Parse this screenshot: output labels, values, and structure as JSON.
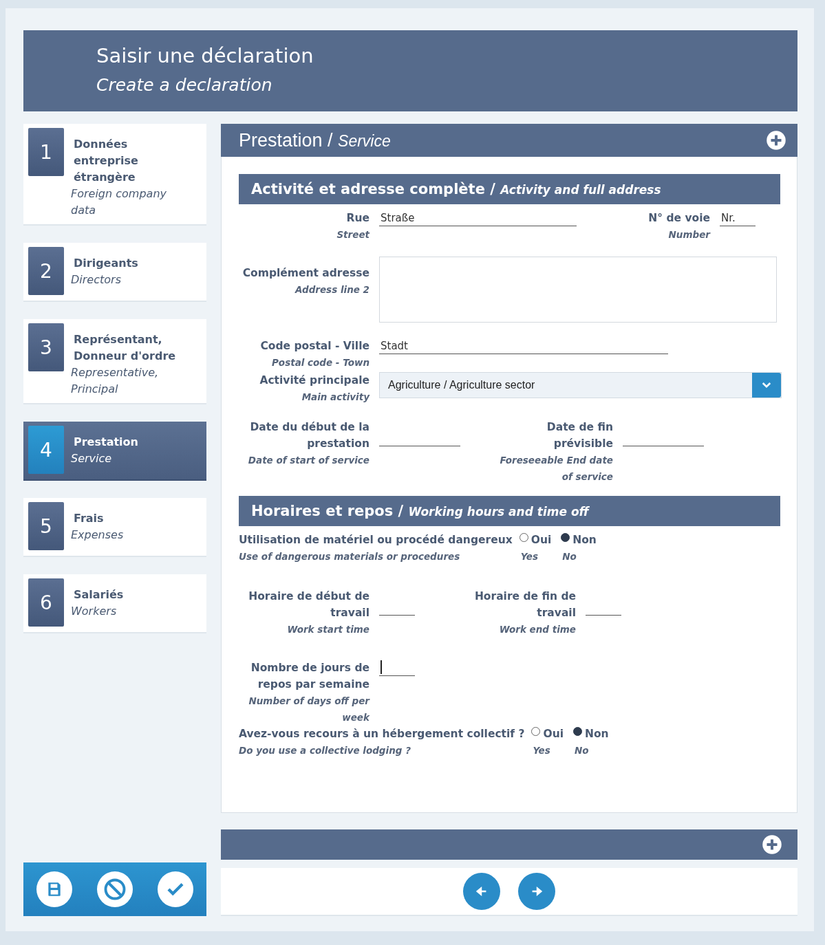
{
  "header": {
    "title": "Saisir une déclaration",
    "subtitle": "Create a declaration"
  },
  "steps": [
    {
      "number": "1",
      "title": "Données entreprise étrangère",
      "subtitle": "Foreign company data",
      "selected": false
    },
    {
      "number": "2",
      "title": "Dirigeants",
      "subtitle": "Directors",
      "selected": false
    },
    {
      "number": "3",
      "title": "Représentant, Donneur d'ordre",
      "subtitle": "Representative, Principal",
      "selected": false
    },
    {
      "number": "4",
      "title": "Prestation",
      "subtitle": "Service",
      "selected": true
    },
    {
      "number": "5",
      "title": "Frais",
      "subtitle": "Expenses",
      "selected": false
    },
    {
      "number": "6",
      "title": "Salariés",
      "subtitle": "Workers",
      "selected": false
    }
  ],
  "panel": {
    "title": "Prestation / *Service*"
  },
  "address_section": {
    "title": "Activité et adresse complète / *Activity and full address*",
    "street": {
      "label": "Rue",
      "label_en": "Street",
      "value": "Straße"
    },
    "number": {
      "label": "N° de voie",
      "label_en": "Number",
      "value": "Nr."
    },
    "address2": {
      "label": "Complément adresse",
      "label_en": "Address line 2"
    },
    "postal": {
      "label": "Code postal - Ville",
      "label_en": "Postal code - Town",
      "value": "Stadt"
    },
    "activity": {
      "label": "Activité principale",
      "label_en": "Main activity",
      "value": "Agriculture / Agriculture sector"
    },
    "start_date": {
      "label": "Date du début de la prestation",
      "label_en": "Date of start of service"
    },
    "end_date": {
      "label": "Date de fin prévisible",
      "label_en": "Foreseeable End date of service"
    }
  },
  "hours_section": {
    "title": "Horaires et repos / *Working hours and time off*",
    "dangerous": {
      "label": "Utilisation de matériel ou procédé dangereux",
      "label_en": "Use of dangerous materials or procedures",
      "options": [
        {
          "label": "Oui",
          "label_en": "Yes",
          "selected": false
        },
        {
          "label": "Non",
          "label_en": "No",
          "selected": true
        }
      ]
    },
    "start_time": {
      "label": "Horaire de début de travail",
      "label_en": "Work start time"
    },
    "end_time": {
      "label": "Horaire de fin de travail",
      "label_en": "Work end time"
    },
    "days_off": {
      "label": "Nombre de jours de repos par semaine",
      "label_en": "Number of days off per week",
      "focused": true
    },
    "lodging": {
      "label": "Avez-vous recours à un hébergement collectif ?",
      "label_en": "Do you use a collective lodging ?",
      "options": [
        {
          "label": "Oui",
          "label_en": "Yes",
          "selected": false
        },
        {
          "label": "Non",
          "label_en": "No",
          "selected": true
        }
      ]
    }
  }
}
